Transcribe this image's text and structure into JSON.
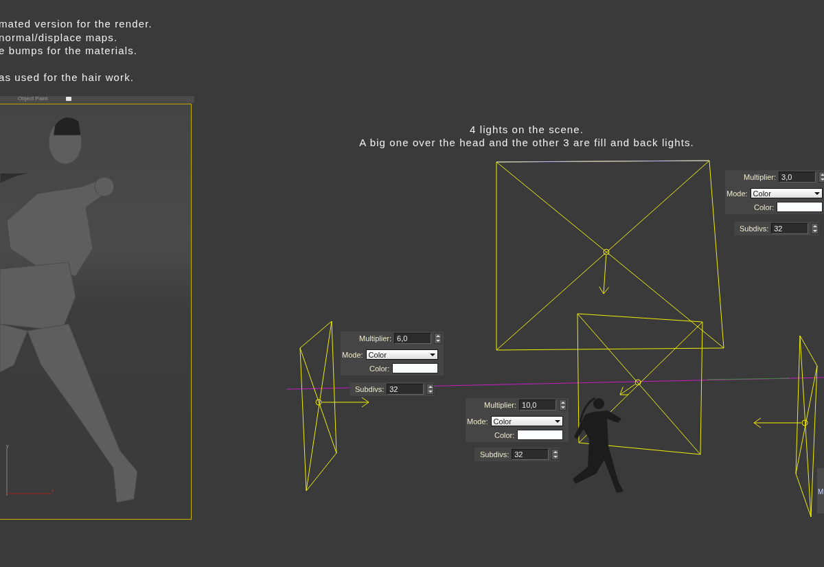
{
  "notes": [
    {
      "text": "mated version for the render.",
      "paragraph_break": false
    },
    {
      "text": "normal/displace maps.",
      "paragraph_break": false
    },
    {
      "text": "e bumps for the materials.",
      "paragraph_break": false
    },
    {
      "text": "as used for the hair work.",
      "paragraph_break": true
    }
  ],
  "viewport": {
    "toolbar_label": "Object Paint",
    "axis_labels": {
      "y": "y",
      "x": "x"
    }
  },
  "scene_caption": [
    "4 lights on the scene.",
    "A big one over the head and the other 3 are fill and back lights."
  ],
  "light_panels": [
    {
      "multiplier_label": "Multiplier:",
      "multiplier": "6,0",
      "mode_label": "Mode:",
      "mode": "Color",
      "color_label": "Color:",
      "subdivs_label": "Subdivs:",
      "subdivs": "32"
    },
    {
      "multiplier_label": "Multiplier:",
      "multiplier": "10,0",
      "mode_label": "Mode:",
      "mode": "Color",
      "color_label": "Color:",
      "subdivs_label": "Subdivs:",
      "subdivs": "32"
    },
    {
      "multiplier_label": "Multiplier:",
      "multiplier": "3,0",
      "mode_label": "Mode:",
      "mode": "Color",
      "color_label": "Color:",
      "subdivs_label": "Subdivs:",
      "subdivs": "32"
    }
  ],
  "partial_panel": {
    "label": "M"
  }
}
